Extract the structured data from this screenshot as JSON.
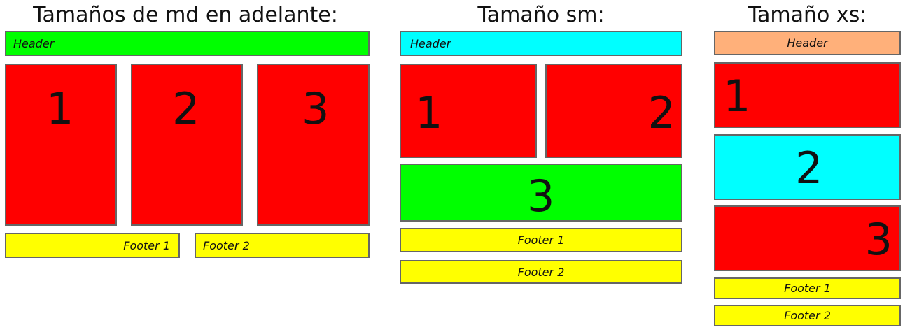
{
  "panels": [
    {
      "title": "Tamaños de md en adelante:",
      "header": "Header",
      "boxes": [
        "1",
        "2",
        "3"
      ],
      "footers": [
        "Footer 1",
        "Footer 2"
      ]
    },
    {
      "title": "Tamaño sm:",
      "header": "Header",
      "boxes": [
        "1",
        "2",
        "3"
      ],
      "footers": [
        "Footer 1",
        "Footer 2"
      ]
    },
    {
      "title": "Tamaño xs:",
      "header": "Header",
      "boxes": [
        "1",
        "2",
        "3"
      ],
      "footers": [
        "Footer 1",
        "Footer 2"
      ]
    }
  ],
  "colors": {
    "red": "#ff0000",
    "green": "#00ff00",
    "cyan": "#00ffff",
    "yellow": "#ffff00",
    "peach": "#ffb07a",
    "border": "#666666"
  }
}
